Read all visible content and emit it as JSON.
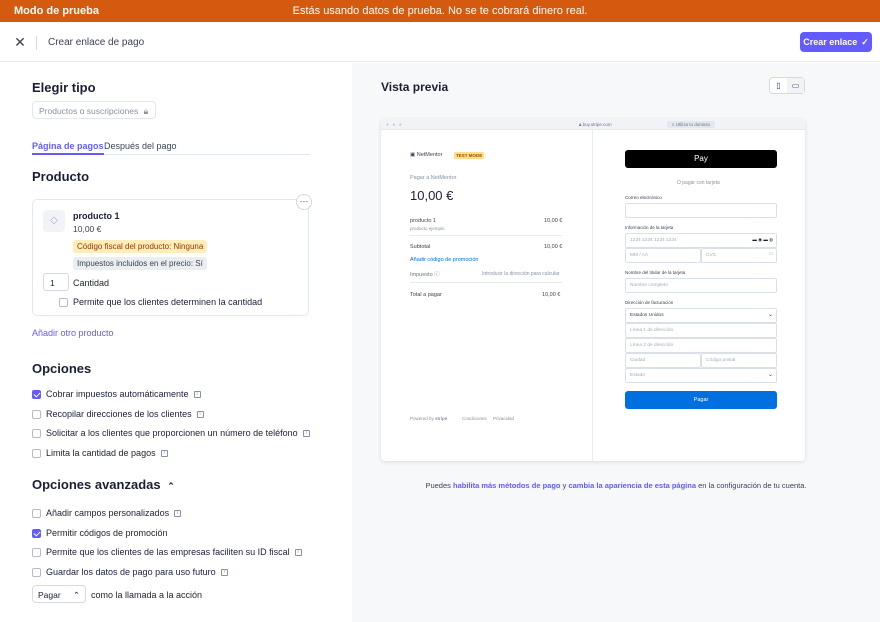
{
  "test_banner": {
    "label": "Modo de prueba",
    "message": "Estás usando datos de prueba. No se te cobrará dinero real."
  },
  "topbar": {
    "title": "Crear enlace de pago",
    "create_button": "Crear enlace"
  },
  "left": {
    "type_heading": "Elegir tipo",
    "type_select": "Productos o suscripciones",
    "tabs": [
      {
        "label": "Página de pagos"
      },
      {
        "label": "Después del pago"
      }
    ],
    "product_heading": "Producto",
    "product": {
      "name": "producto 1",
      "price": "10,00 €",
      "tax_badge": "Código fiscal del producto: Ninguna",
      "tax_included_badge": "Impuestos incluidos en el precio: Sí",
      "quantity": "1",
      "quantity_label": "Cantidad",
      "adjust_qty_label": "Permite que los clientes determinen la cantidad"
    },
    "add_product": "Añadir otro producto",
    "options_heading": "Opciones",
    "options": [
      {
        "label": "Cobrar impuestos automáticamente",
        "checked": true
      },
      {
        "label": "Recopilar direcciones de los clientes",
        "checked": false
      },
      {
        "label": "Solicitar a los clientes que proporcionen un número de teléfono",
        "checked": false
      },
      {
        "label": "Limita la cantidad de pagos",
        "checked": false
      }
    ],
    "advanced_heading": "Opciones avanzadas",
    "advanced": [
      {
        "label": "Añadir campos personalizados",
        "checked": false
      },
      {
        "label": "Permitir códigos de promoción",
        "checked": true
      },
      {
        "label": "Permite que los clientes de las empresas faciliten su ID fiscal",
        "checked": false
      },
      {
        "label": "Guardar los datos de pago para uso futuro",
        "checked": false
      }
    ],
    "cta_select": "Pagar",
    "cta_label": "como la llamada a la acción"
  },
  "preview": {
    "title": "Vista previa",
    "url": "buy.stripe.com",
    "domain_btn": "Utiliza tu dominio",
    "merchant": "NetMentor",
    "test_badge": "TEST MODE",
    "pay_to": "Pagar a NetMentor",
    "amount": "10,00 €",
    "item_name": "producto 1",
    "item_desc": "producto ejemplo",
    "item_price": "10,00 €",
    "subtotal_label": "Subtotal",
    "subtotal_value": "10,00 €",
    "promo_link": "Añadir código de promoción",
    "tax_label": "Impuesto",
    "tax_value": "Introducir la dirección para calcular",
    "total_label": "Total a pagar",
    "total_value": "10,00 €",
    "powered": "Powered by",
    "stripe": "stripe",
    "conditions": "Condiciones",
    "privacy": "Privacidad",
    "applepay": "Pay",
    "or_card": "O pagar con tarjeta",
    "email_label": "Correo electrónico",
    "card_label": "Información de la tarjeta",
    "card_placeholder": "1234 1234 1234 1234",
    "exp_placeholder": "MM / AA",
    "cvc_placeholder": "CVC",
    "holder_label": "Nombre del titular de la tarjeta",
    "holder_placeholder": "Nombre completo",
    "billing_label": "Dirección de facturación",
    "country": "Estados Unidos",
    "line1": "Línea 1 de dirección",
    "line2": "Línea 2 de dirección",
    "city": "Ciudad",
    "zip": "Código postal",
    "state": "Estado",
    "pay_button": "Pagar"
  },
  "footer": {
    "pre": "Puedes",
    "link1": "habilita más métodos de pago",
    "mid": "y",
    "link2": "cambia la apariencia de esta página",
    "post": "en la configuración de tu cuenta."
  },
  "colors": {
    "accent": "#635bff",
    "test_banner": "#d35a0f",
    "pay_button": "#0070e0"
  }
}
